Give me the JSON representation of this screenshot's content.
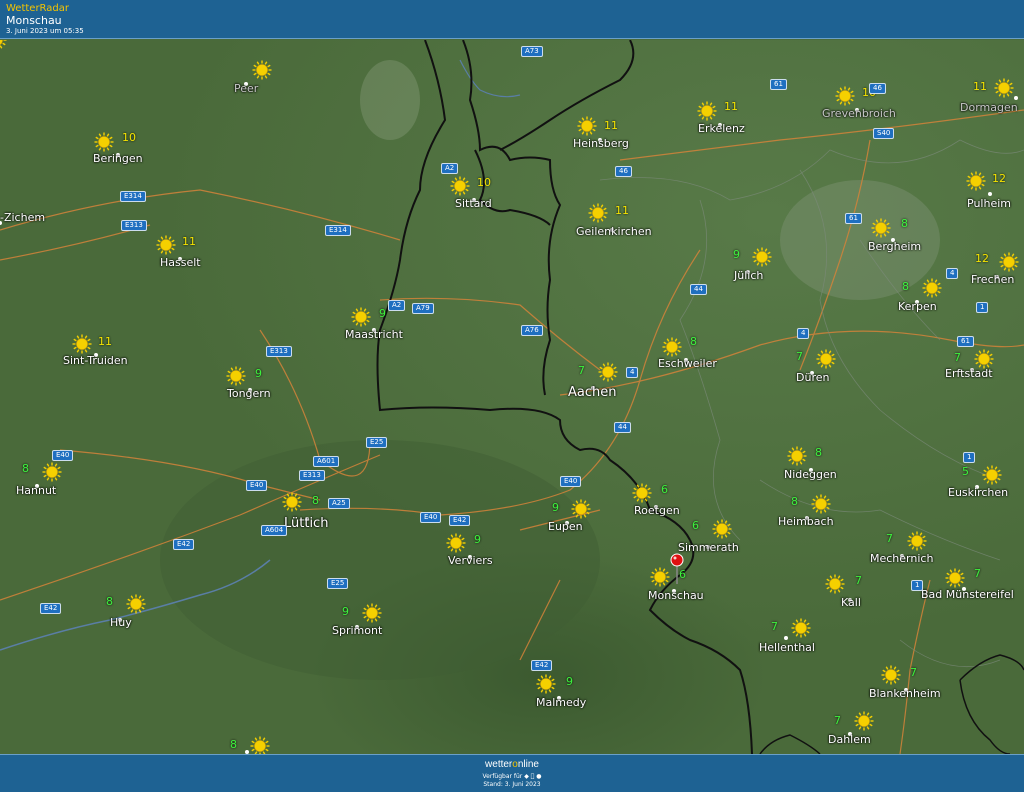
{
  "header": {
    "brand": "WetterRadar",
    "location": "Monschau",
    "timestamp": "3. Juni 2023 um 05:35"
  },
  "footer": {
    "logo_part1": "wetter",
    "logo_part2": "o",
    "logo_part3": "nline",
    "available": "Verfügbar für",
    "stand": "Stand: 3. Juni 2023"
  },
  "colors": {
    "header_bg": "#1e6293",
    "temp_green": "#3df23d",
    "temp_yellow": "#f5e400",
    "sun": "#f5d000",
    "road_shield": "#1f6fc0",
    "pin": "#e01010"
  },
  "cities": [
    {
      "name": "Peer",
      "temp": "",
      "muted": true
    },
    {
      "name": "Beringen",
      "temp": "10"
    },
    {
      "name": "-Zichem",
      "temp": ""
    },
    {
      "name": "Hasselt",
      "temp": "11"
    },
    {
      "name": "Sint-Truiden",
      "temp": "11"
    },
    {
      "name": "Tongern",
      "temp": "9"
    },
    {
      "name": "Hannut",
      "temp": "8"
    },
    {
      "name": "Huy",
      "temp": "8"
    },
    {
      "name": "Maastricht",
      "temp": "9"
    },
    {
      "name": "Lüttich",
      "temp": "8",
      "big": true
    },
    {
      "name": "Sprimont",
      "temp": "9"
    },
    {
      "name": "Verviers",
      "temp": "9"
    },
    {
      "name": "Eupen",
      "temp": "9"
    },
    {
      "name": "Malmedy",
      "temp": "9"
    },
    {
      "name": "Sittard",
      "temp": "10"
    },
    {
      "name": "Heinsberg",
      "temp": "11"
    },
    {
      "name": "Geilenkirchen",
      "temp": "11"
    },
    {
      "name": "Aachen",
      "temp": "7",
      "big": true
    },
    {
      "name": "Roetgen",
      "temp": "6"
    },
    {
      "name": "Simmerath",
      "temp": "6"
    },
    {
      "name": "Monschau",
      "temp": "6"
    },
    {
      "name": "Erkelenz",
      "temp": "11"
    },
    {
      "name": "Jülich",
      "temp": "9"
    },
    {
      "name": "Eschweiler",
      "temp": "8"
    },
    {
      "name": "Düren",
      "temp": "7"
    },
    {
      "name": "Nideggen",
      "temp": "8"
    },
    {
      "name": "Heimbach",
      "temp": "8"
    },
    {
      "name": "Hellenthal",
      "temp": "7"
    },
    {
      "name": "Kall",
      "temp": "7"
    },
    {
      "name": "Mechernich",
      "temp": "7"
    },
    {
      "name": "Blankenheim",
      "temp": "7"
    },
    {
      "name": "Dahlem",
      "temp": "7"
    },
    {
      "name": "Grevenbroich",
      "temp": "10",
      "muted": true
    },
    {
      "name": "Dormagen",
      "temp": "11",
      "muted": true
    },
    {
      "name": "Pulheim",
      "temp": "12"
    },
    {
      "name": "Bergheim",
      "temp": "8"
    },
    {
      "name": "Frechen",
      "temp": "12"
    },
    {
      "name": "Kerpen",
      "temp": "8"
    },
    {
      "name": "Erftstadt",
      "temp": "7"
    },
    {
      "name": "Euskirchen",
      "temp": "5"
    },
    {
      "name": "Bad Münstereifel",
      "temp": "7"
    },
    {
      "name": "",
      "temp": "8"
    }
  ],
  "roads": [
    "A73",
    "A2",
    "A2",
    "A79",
    "A76",
    "E314",
    "E313",
    "E314",
    "E313",
    "E25",
    "E40",
    "E313",
    "A601",
    "E40",
    "A25",
    "A604",
    "E42",
    "E42",
    "E25",
    "E40",
    "E42",
    "E40",
    "E42",
    "46",
    "4",
    "44",
    "44",
    "61",
    "46",
    "S40",
    "61",
    "4",
    "61",
    "4",
    "1",
    "1",
    "1"
  ]
}
